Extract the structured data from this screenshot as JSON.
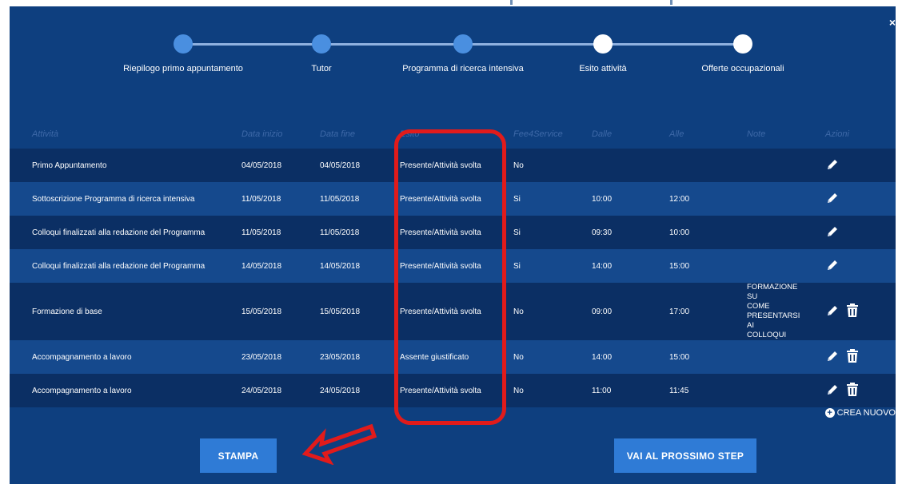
{
  "close_glyph": "×",
  "stepper": {
    "steps": [
      {
        "label": "Riepilogo primo appuntamento",
        "state": "done"
      },
      {
        "label": "Tutor",
        "state": "done"
      },
      {
        "label": "Programma di ricerca intensiva",
        "state": "done"
      },
      {
        "label": "Esito attività",
        "state": "current"
      },
      {
        "label": "Offerte occupazionali",
        "state": "todo"
      }
    ]
  },
  "table": {
    "headers": {
      "attivita": "Attività",
      "data_inizio": "Data inizio",
      "data_fine": "Data fine",
      "esito": "Esito",
      "fee": "Fee4Service",
      "dalle": "Dalle",
      "alle": "Alle",
      "note": "Note",
      "azioni": "Azioni"
    },
    "rows": [
      {
        "attivita": "Primo Appuntamento",
        "data_inizio": "04/05/2018",
        "data_fine": "04/05/2018",
        "esito": "Presente/Attività svolta",
        "fee": "No",
        "dalle": "",
        "alle": "",
        "note": ""
      },
      {
        "attivita": "Sottoscrizione Programma di ricerca intensiva",
        "data_inizio": "11/05/2018",
        "data_fine": "11/05/2018",
        "esito": "Presente/Attività svolta",
        "fee": "Si",
        "dalle": "10:00",
        "alle": "12:00",
        "note": ""
      },
      {
        "attivita": "Colloqui finalizzati alla redazione del Programma",
        "data_inizio": "11/05/2018",
        "data_fine": "11/05/2018",
        "esito": "Presente/Attività svolta",
        "fee": "Si",
        "dalle": "09:30",
        "alle": "10:00",
        "note": ""
      },
      {
        "attivita": "Colloqui finalizzati alla redazione del Programma",
        "data_inizio": "14/05/2018",
        "data_fine": "14/05/2018",
        "esito": "Presente/Attività svolta",
        "fee": "Si",
        "dalle": "14:00",
        "alle": "15:00",
        "note": ""
      },
      {
        "attivita": "Formazione di base",
        "data_inizio": "15/05/2018",
        "data_fine": "15/05/2018",
        "esito": "Presente/Attività svolta",
        "fee": "No",
        "dalle": "09:00",
        "alle": "17:00",
        "note": "FORMAZIONE SU\nCOME\nPRESENTARSI AI\nCOLLOQUI"
      },
      {
        "attivita": "Accompagnamento a lavoro",
        "data_inizio": "23/05/2018",
        "data_fine": "23/05/2018",
        "esito": "Assente giustificato",
        "fee": "No",
        "dalle": "14:00",
        "alle": "15:00",
        "note": ""
      },
      {
        "attivita": "Accompagnamento a lavoro",
        "data_inizio": "24/05/2018",
        "data_fine": "24/05/2018",
        "esito": "Presente/Attività svolta",
        "fee": "No",
        "dalle": "11:00",
        "alle": "11:45",
        "note": ""
      }
    ]
  },
  "crea_nuovo_label": "CREA NUOVO",
  "buttons": {
    "stampa": "STAMPA",
    "next": "VAI AL PROSSIMO STEP"
  },
  "colors": {
    "panel": "#0e3f7f",
    "row_dark": "#0b2f64",
    "row_light": "#15498d",
    "button": "#2f7bd6",
    "step_done": "#4a8fe0",
    "highlight": "#e11b1b"
  }
}
